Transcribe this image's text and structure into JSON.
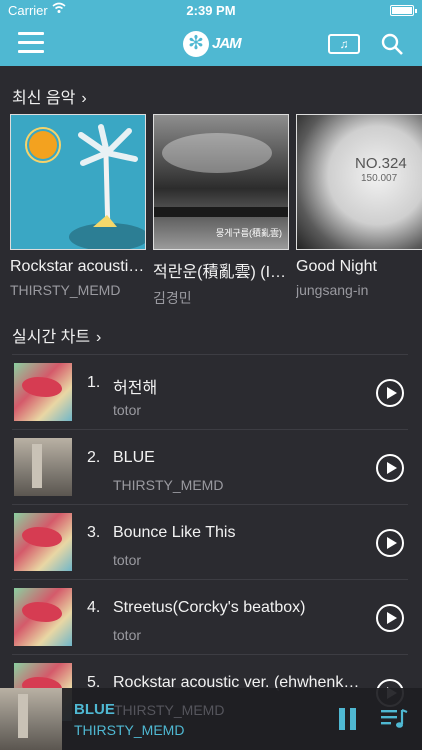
{
  "status_bar": {
    "carrier": "Carrier",
    "time": "2:39 PM"
  },
  "nav": {
    "logo_text": "JAM",
    "ticket_label": "♫"
  },
  "sections": {
    "latest": "최신 음악",
    "chart": "실시간 차트"
  },
  "albums": [
    {
      "title": "Rockstar acoustic ver.",
      "artist": "THIRSTY_MEMD"
    },
    {
      "title": "적란운(積亂雲) (I…",
      "artist": "김경민"
    },
    {
      "title": "Good Night",
      "artist": "jungsang-in"
    }
  ],
  "cover_texts": {
    "album2": "뭉게구름(積亂雲)",
    "album3_no": "NO.324",
    "album3_sub": "150.007"
  },
  "chart": [
    {
      "rank": "1.",
      "title": "허전해",
      "artist": "totor"
    },
    {
      "rank": "2.",
      "title": "BLUE",
      "artist": "THIRSTY_MEMD"
    },
    {
      "rank": "3.",
      "title": "Bounce Like This",
      "artist": "totor"
    },
    {
      "rank": "4.",
      "title": "Streetus(Corcky's beatbox)",
      "artist": "totor"
    },
    {
      "rank": "5.",
      "title": "Rockstar acoustic ver. (ehwhenk…",
      "artist": ""
    }
  ],
  "player": {
    "title": "BLUE",
    "artist": "THIRSTY_MEMD",
    "overlay_artist": "THIRSTY_MEMD"
  },
  "colors": {
    "accent": "#4fb8d2",
    "background": "#2b2b30"
  }
}
